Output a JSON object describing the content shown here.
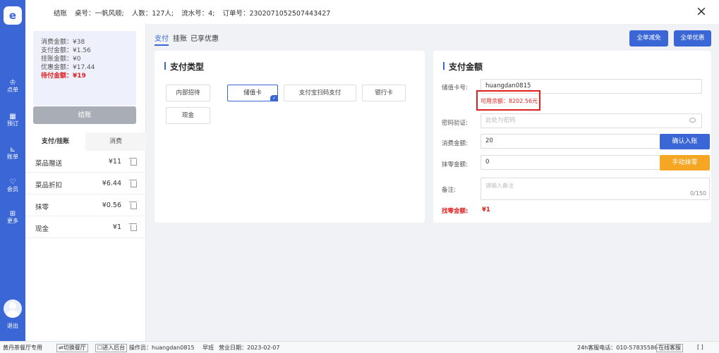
{
  "nav": {
    "logo": "e",
    "items": [
      {
        "icon": "♔",
        "label": "点单"
      },
      {
        "icon": "▦",
        "label": "预订"
      },
      {
        "icon": "⊾",
        "label": "账单"
      },
      {
        "icon": "♡",
        "label": "会员"
      },
      {
        "icon": "⊞",
        "label": "更多"
      }
    ],
    "logout": "退出"
  },
  "header": {
    "title": "结账",
    "table": "桌号：一帆风顺;",
    "guests": "人数：127人;",
    "serial": "流水号：4;",
    "order": "订单号：2302071052507443427",
    "close": "×"
  },
  "summary": {
    "consume": "消费金额：¥38",
    "paid": "支付金额：¥1.56",
    "credit": "挂账金额：¥0",
    "discount": "优惠金额：¥17.44",
    "due": "待付金额：¥19"
  },
  "settle_button": "结账",
  "left_tabs": {
    "active": "支付/挂账",
    "other": "消费"
  },
  "payments": [
    {
      "name": "菜品赠送",
      "amount": "¥11"
    },
    {
      "name": "菜品折扣",
      "amount": "¥6.44"
    },
    {
      "name": "抹零",
      "amount": "¥0.56"
    },
    {
      "name": "现金",
      "amount": "¥1"
    }
  ],
  "main_tabs": [
    "支付",
    "挂账",
    "已享优惠"
  ],
  "actions": {
    "whole_reduce": "全单减免",
    "whole_discount": "全单优惠"
  },
  "pay_type": {
    "title": "支付类型",
    "options": [
      "内部招待",
      "储值卡",
      "支付宝扫码支付",
      "银行卡",
      "现金"
    ],
    "selected": "储值卡"
  },
  "pay_amount": {
    "title": "支付金额",
    "card_label": "储值卡号:",
    "card_value": "huangdan0815",
    "balance": "可用余额：8202.56元",
    "pwd_label": "密码验证:",
    "pwd_placeholder": "此处为密码",
    "consume_label": "消费金额:",
    "consume_value": "20",
    "confirm_button": "确认入账",
    "round_label": "抹零金额:",
    "round_value": "0",
    "round_button": "手动抹零",
    "note_label": "备注:",
    "note_placeholder": "请输入备注",
    "note_count": "0/150",
    "change_label": "找零金额:",
    "change_value": "¥1"
  },
  "colors": {
    "accent": "#3a66d6",
    "warn": "#f5a623",
    "danger": "#e02020"
  },
  "footer": {
    "brand": "黄丹茶餐厅专用",
    "switch": "⇌切换餐厅",
    "backend": "☐进入后台",
    "operator": "操作员：huangdan0815",
    "shift": "早班",
    "date": "营业日期：2023-02-07",
    "hotline": "24h客服电话：010-57835586",
    "online": "在线客服",
    "expand": "[ ]"
  }
}
